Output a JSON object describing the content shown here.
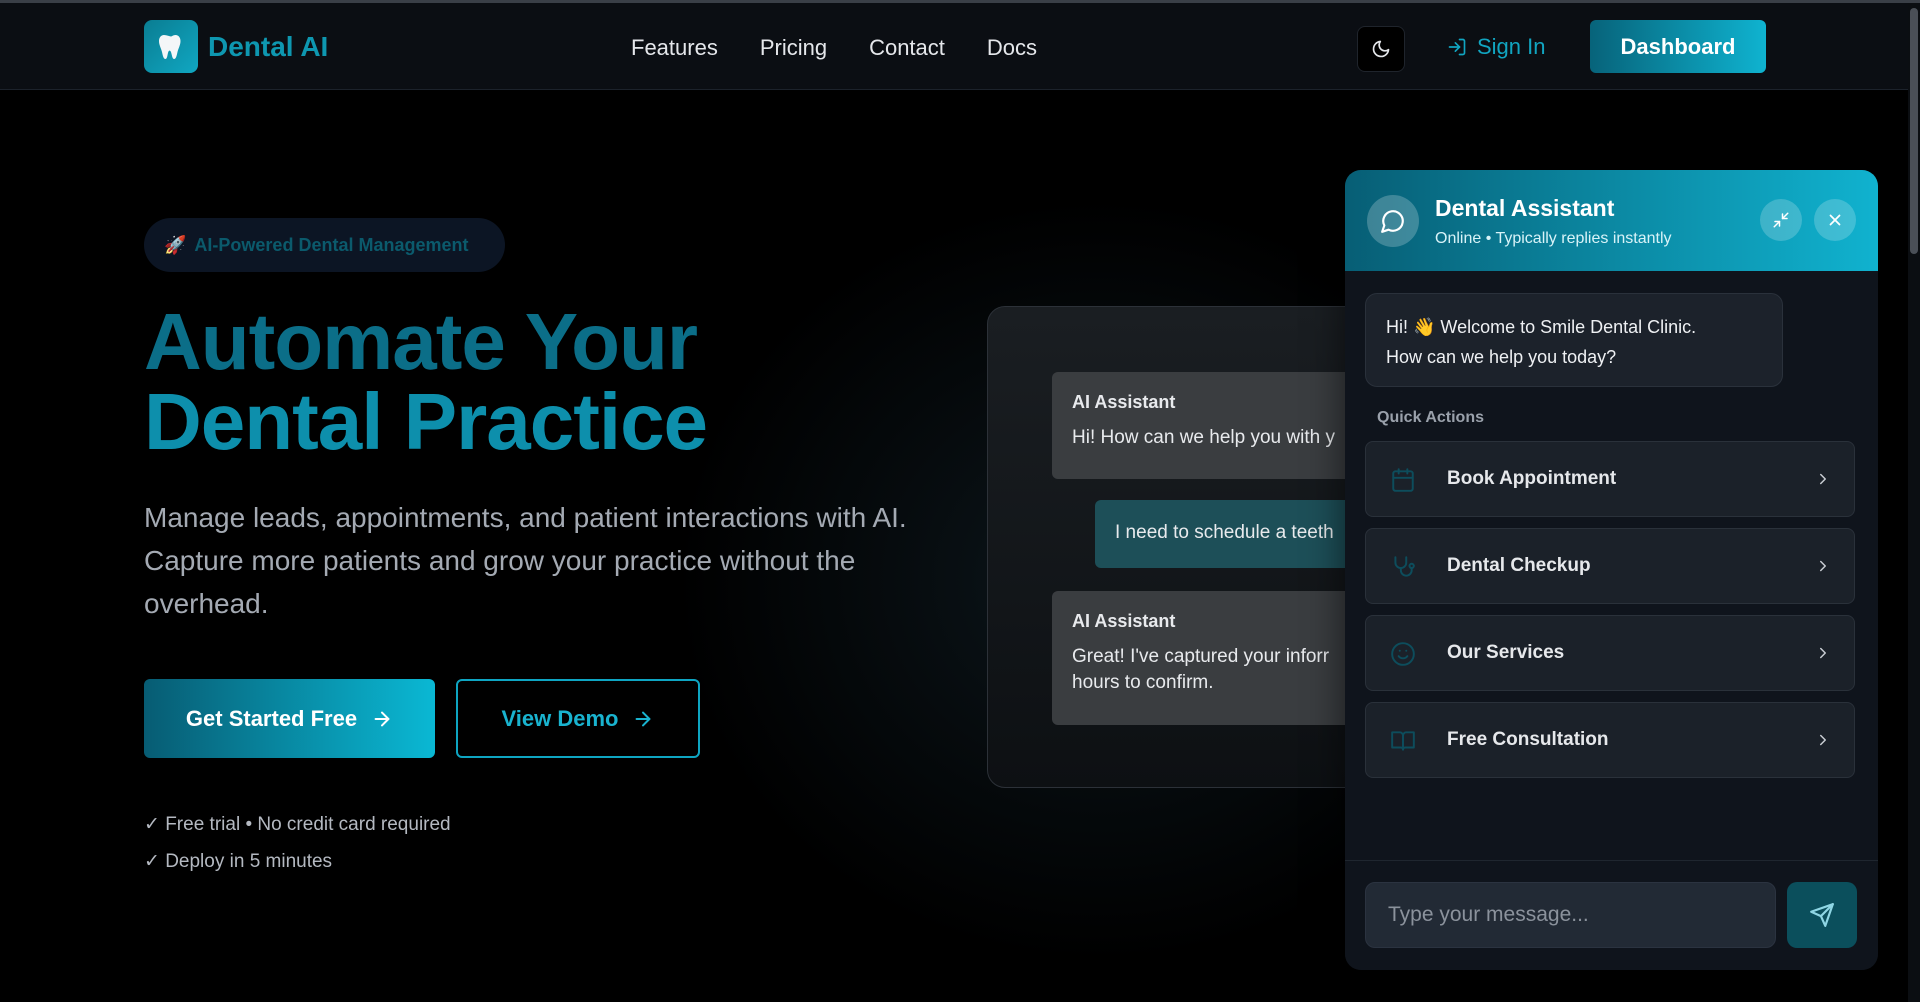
{
  "nav": {
    "logo_text": "Dental AI",
    "links": [
      "Features",
      "Pricing",
      "Contact",
      "Docs"
    ],
    "sign_in": "Sign In",
    "dashboard": "Dashboard",
    "accent_color": "#0e97b0"
  },
  "hero": {
    "badge": "AI-Powered Dental Management",
    "badge_emoji": "🚀",
    "title_line1": "Automate Your",
    "title_line2": "Dental Practice",
    "subtitle": "Manage leads, appointments, and patient interactions with AI. Capture more patients and grow your practice without the overhead.",
    "primary_cta": "Get Started Free",
    "secondary_cta": "View Demo",
    "checks": [
      "✓ Free trial • No credit card required",
      "✓ Deploy in 5 minutes"
    ]
  },
  "preview": {
    "messages": [
      {
        "from": "AI Assistant",
        "text": "Hi! How can we help you with y"
      },
      {
        "from": "user",
        "text": "I need to schedule a teeth"
      },
      {
        "from": "AI Assistant",
        "text_line1": "Great! I've captured your inforr",
        "text_line2": "hours to confirm."
      }
    ]
  },
  "chat": {
    "title": "Dental Assistant",
    "status": "Online • Typically replies instantly",
    "welcome_line1": "Hi! 👋 Welcome to Smile Dental Clinic.",
    "welcome_line2": "How can we help you today?",
    "quick_actions_label": "Quick Actions",
    "quick_actions": [
      {
        "label": "Book Appointment",
        "icon": "calendar-icon"
      },
      {
        "label": "Dental Checkup",
        "icon": "stethoscope-icon"
      },
      {
        "label": "Our Services",
        "icon": "smile-icon"
      },
      {
        "label": "Free Consultation",
        "icon": "book-icon"
      }
    ],
    "input_placeholder": "Type your message..."
  }
}
